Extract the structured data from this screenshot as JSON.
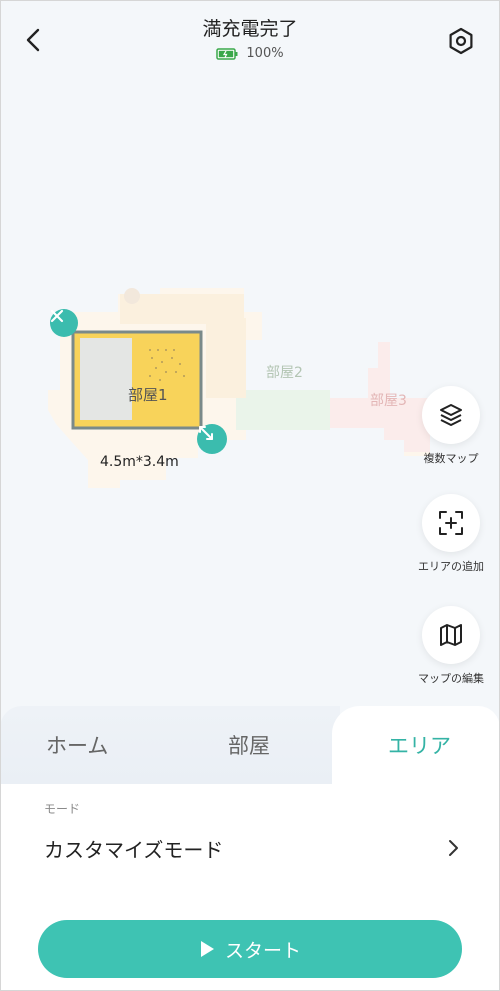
{
  "header": {
    "title": "満充電完了",
    "battery_text": "100%",
    "battery_level_percent": 100
  },
  "map": {
    "rooms": [
      {
        "label": "部屋1"
      },
      {
        "label": "部屋2"
      },
      {
        "label": "部屋3"
      }
    ],
    "zone_dimensions": "4.5m*3.4m"
  },
  "side_actions": [
    {
      "label": "複数マップ",
      "icon": "layers-icon"
    },
    {
      "label": "エリアの追加",
      "icon": "add-area-icon"
    },
    {
      "label": "マップの編集",
      "icon": "map-edit-icon"
    }
  ],
  "tabs": [
    {
      "label": "ホーム",
      "active": false
    },
    {
      "label": "部屋",
      "active": false
    },
    {
      "label": "エリア",
      "active": true
    }
  ],
  "mode": {
    "label": "モード",
    "value": "カスタマイズモード"
  },
  "start_button": {
    "label": "スタート"
  },
  "colors": {
    "accent": "#3ec3b3",
    "zone_fill": "#f8d35a",
    "zone_border": "#7a8a8a"
  }
}
